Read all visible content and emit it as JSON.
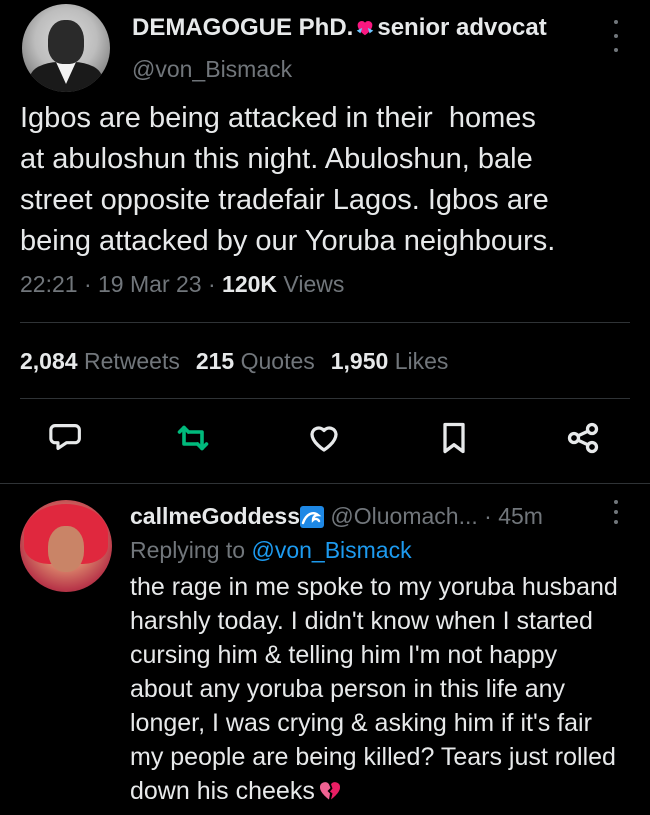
{
  "tweet": {
    "author": {
      "display_name_prefix": "DEMAGOGUE PhD.",
      "display_name_suffix": "senior advocat",
      "handle": "@von_Bismack"
    },
    "text": "Igbos are being attacked in their  homes\nat abuloshun this night. Abuloshun, bale\nstreet opposite tradefair Lagos. Igbos are\nbeing attacked by our Yoruba neighbours.",
    "time": "22:21",
    "date": "19 Mar 23",
    "separator": "·",
    "views_count": "120K",
    "views_label": "Views",
    "stats": {
      "retweets_count": "2,084",
      "retweets_label": "Retweets",
      "quotes_count": "215",
      "quotes_label": "Quotes",
      "likes_count": "1,950",
      "likes_label": "Likes"
    },
    "actions": [
      "reply-icon",
      "retweet-icon",
      "like-icon",
      "bookmark-icon",
      "share-icon"
    ]
  },
  "reply": {
    "author_name": "callmeGoddess",
    "handle": "@Oluomach...",
    "separator": "·",
    "time": "45m",
    "replying_prefix": "Replying to",
    "replying_to": "@von_Bismack",
    "text": "the rage in me spoke to my yoruba husband\nharshly today. I didn't know when I started\ncursing him & telling him I'm not happy\nabout any yoruba person in this life any\nlonger, I was crying & asking him if it's fair\nmy people are being killed? Tears just rolled\ndown his cheeks"
  },
  "colors": {
    "background": "#000000",
    "text": "#e7e9ea",
    "muted": "#71767b",
    "accent_blue": "#1d9bf0",
    "retweet_green": "#00ba7c",
    "heart_pink": "#f91880"
  }
}
